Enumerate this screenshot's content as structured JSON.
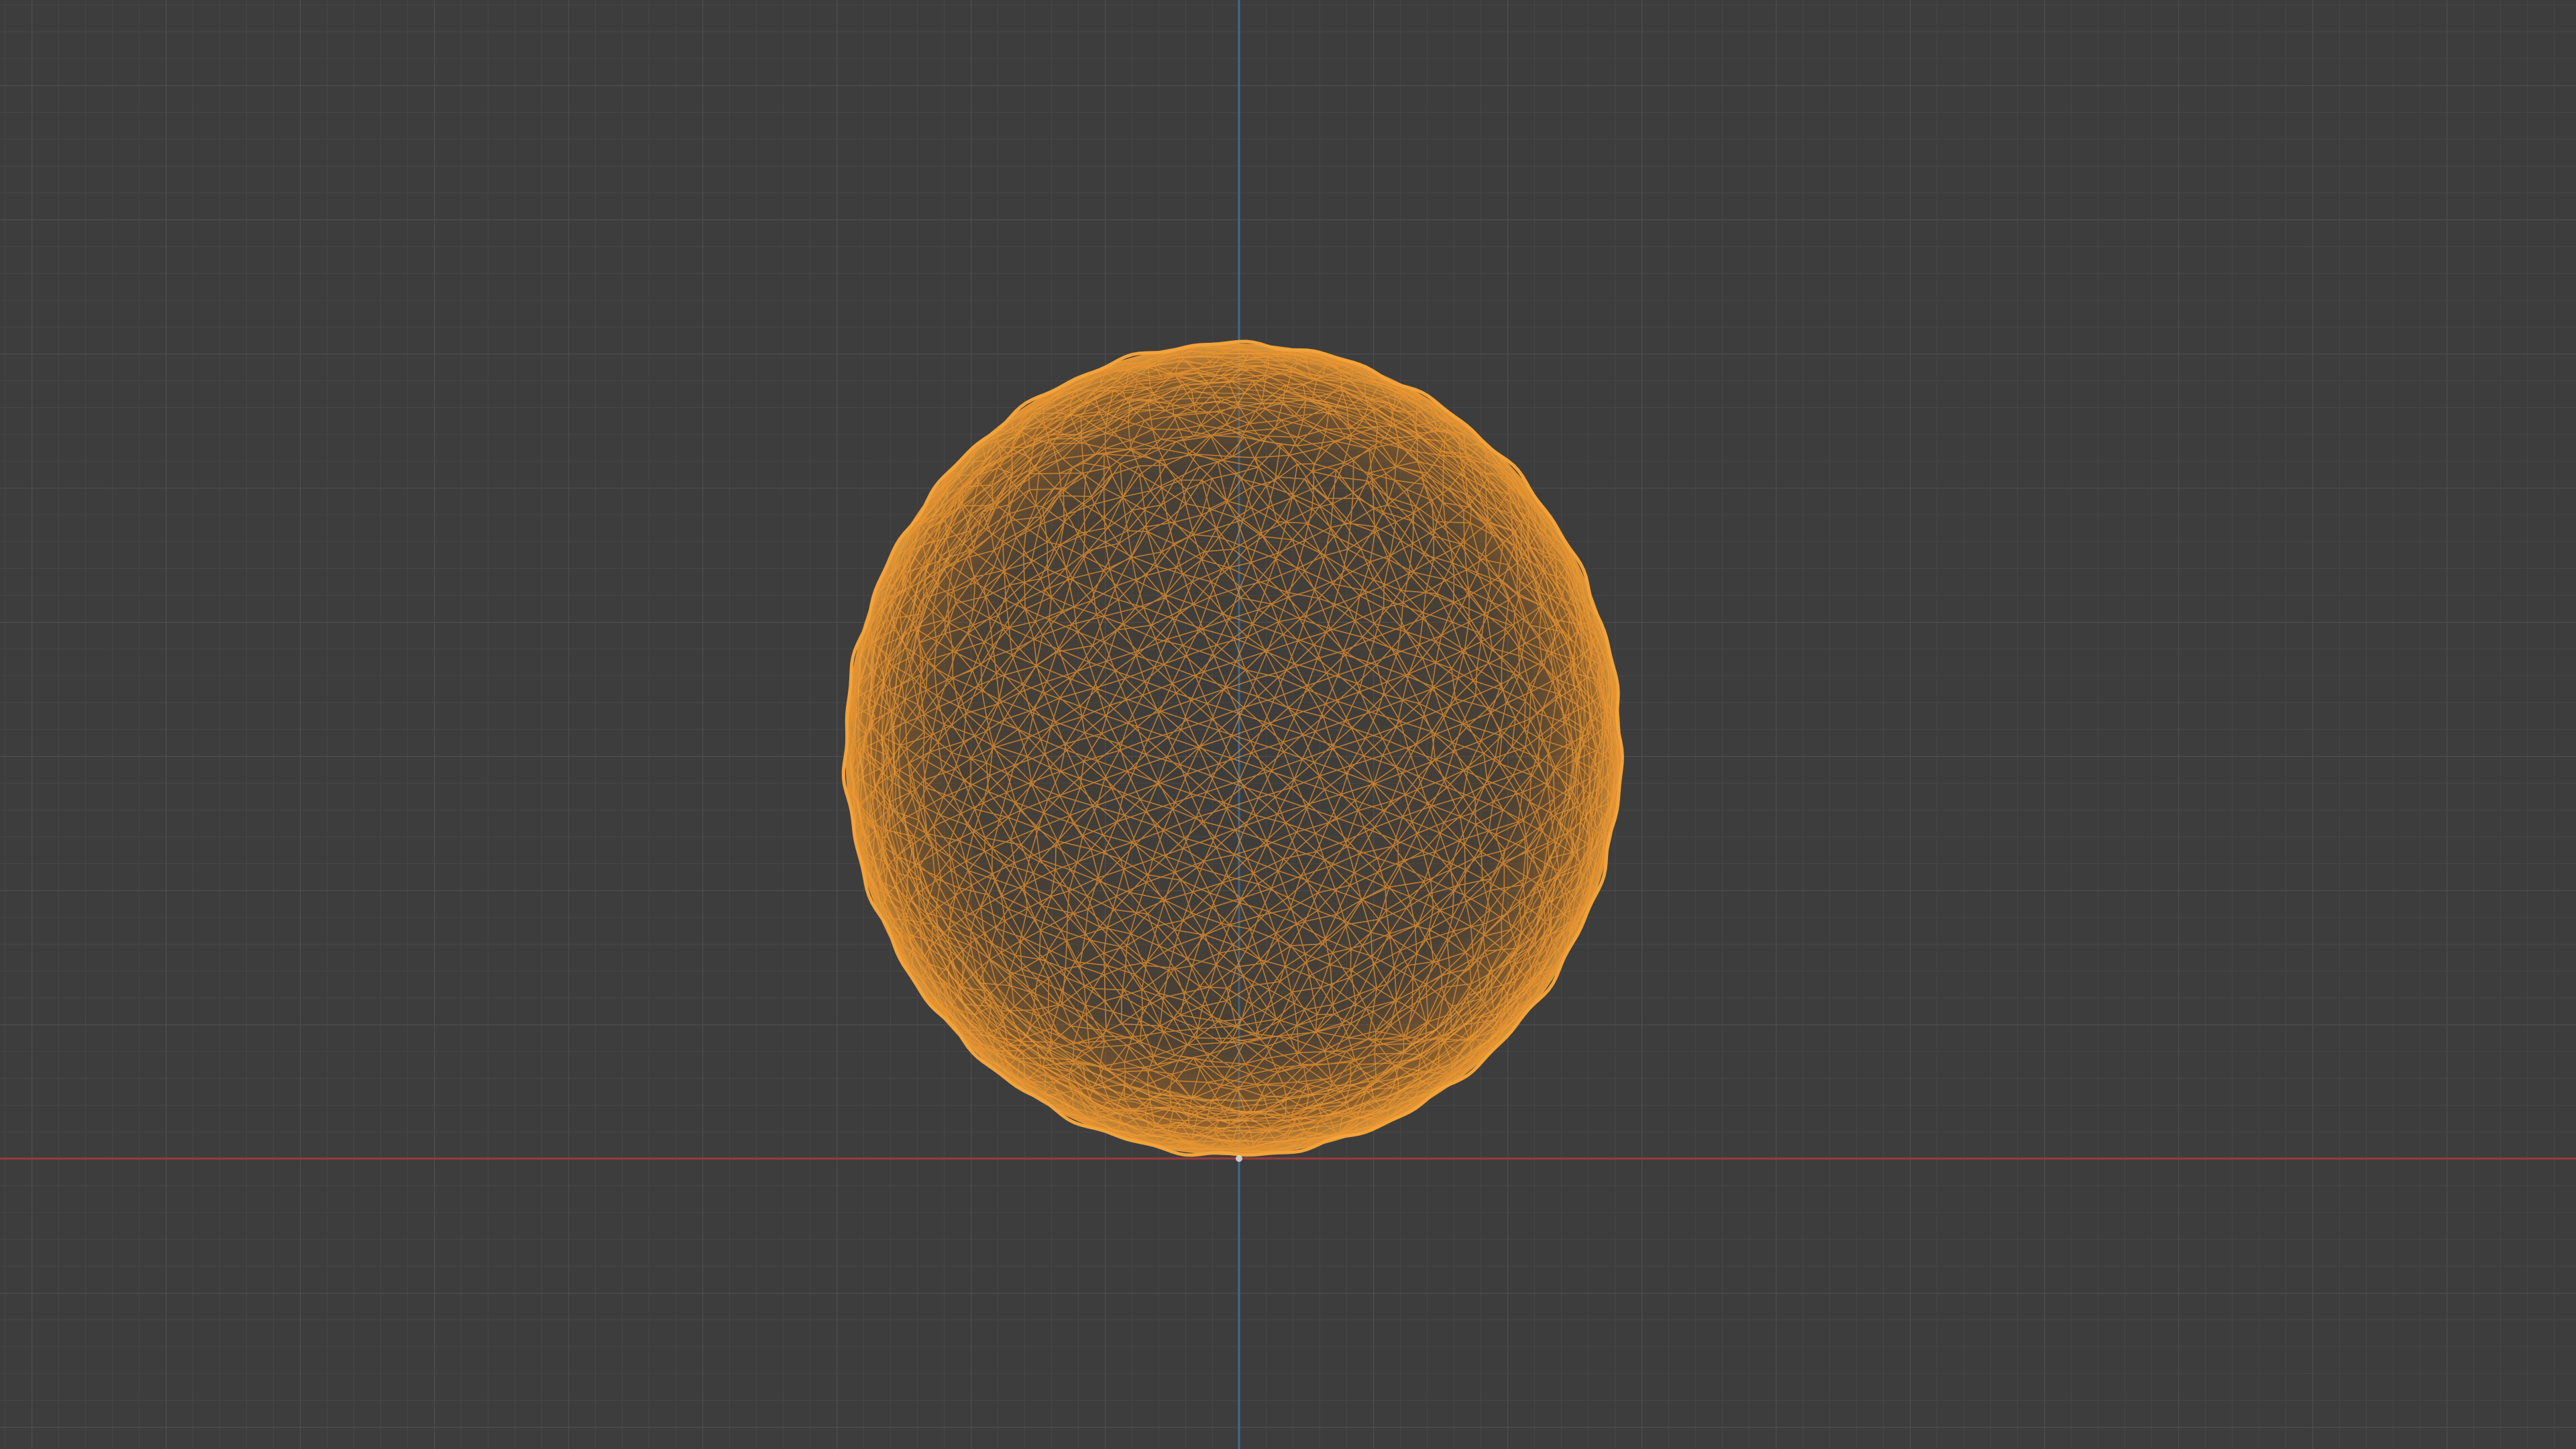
{
  "app": {
    "view": "3d-viewport",
    "shading": "wireframe"
  },
  "colors": {
    "background": "#3d3d3d",
    "grid_minor": "#464646",
    "grid_major": "#4e4e4e",
    "x_axis": "#9a3a3a",
    "y_axis": "#3f6a8f",
    "mesh_wire": "#e8922f",
    "mesh_wire_dense": "#f2a33a",
    "mesh_fill_shadow": "#4a3c2c"
  },
  "scene": {
    "objects": [
      {
        "name": "",
        "kind": "sphere-mesh",
        "selected": true
      }
    ]
  },
  "icons": {
    "origin": "origin-icon"
  }
}
